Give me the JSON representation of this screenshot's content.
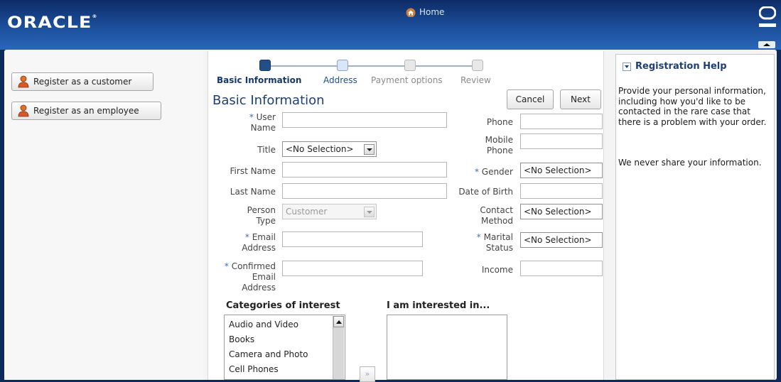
{
  "header": {
    "logo": "ORACLE",
    "logo_mark": "®",
    "home_label": "Home"
  },
  "left_panel": {
    "register_customer": "Register as a customer",
    "register_employee": "Register as an employee"
  },
  "train": {
    "steps": [
      {
        "label": "Basic Information",
        "state": "current"
      },
      {
        "label": "Address",
        "state": "enabled"
      },
      {
        "label": "Payment options",
        "state": "disabled"
      },
      {
        "label": "Review",
        "state": "disabled"
      }
    ]
  },
  "form": {
    "title": "Basic Information",
    "cancel_label": "Cancel",
    "next_label": "Next",
    "required_mark": "*",
    "user_name_label_1": "User",
    "user_name_label_2": "Name",
    "title_label": "Title",
    "title_value": "<No Selection>",
    "first_name_label": "First Name",
    "last_name_label": "Last Name",
    "person_type_label_1": "Person",
    "person_type_label_2": "Type",
    "person_type_value": "Customer",
    "email_label_1": "Email",
    "email_label_2": "Address",
    "confirmed_email_label_1": "Confirmed",
    "confirmed_email_label_2": "Email",
    "confirmed_email_label_3": "Address",
    "phone_label": "Phone",
    "mobile_label_1": "Mobile",
    "mobile_label_2": "Phone",
    "gender_label": "Gender",
    "gender_value": "<No Selection>",
    "dob_label": "Date of Birth",
    "contact_label_1": "Contact",
    "contact_label_2": "Method",
    "contact_value": "<No Selection>",
    "marital_label_1": "Marital",
    "marital_label_2": "Status",
    "marital_value": "<No Selection>",
    "income_label": "Income"
  },
  "interests": {
    "categories_heading": "Categories of interest",
    "selected_heading": "I am interested in...",
    "categories": [
      "Audio and Video",
      "Books",
      "Camera and Photo",
      "Cell Phones"
    ],
    "move_symbol": "»"
  },
  "help": {
    "title": "Registration Help",
    "paragraph_1": "Provide your personal information, including how you'd like to be contacted in the rare case that there is a problem with your order.",
    "paragraph_2": "We never share your information."
  },
  "colors": {
    "header_dark": "#0d2c66",
    "accent": "#1d3f74",
    "required": "#3e70b6"
  }
}
